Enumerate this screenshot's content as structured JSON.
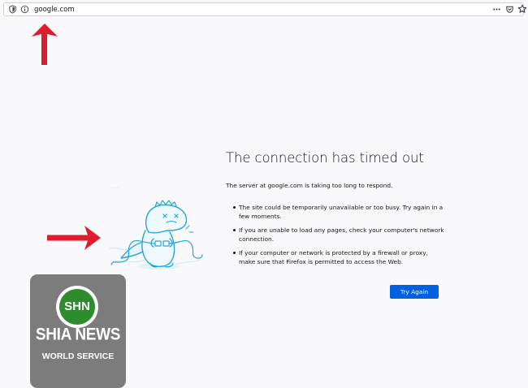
{
  "urlbar": {
    "url": "google.com",
    "icons": [
      "tracking-shield-icon",
      "site-info-icon",
      "page-actions-icon",
      "pocket-icon",
      "bookmark-star-icon"
    ]
  },
  "annotations": {
    "color": "#e01b2e",
    "icons": [
      "red-arrow-up-icon",
      "red-arrow-right-icon"
    ]
  },
  "error": {
    "title": "The connection has timed out",
    "description": "The server at google.com is taking too long to respond.",
    "reasons": [
      "The site could be temporarily unavailable or too busy. Try again in a few moments.",
      "If you are unable to load any pages, check your computer's network connection.",
      "If your computer or network is protected by a firewall or proxy, make sure that Firefox is permitted to access the Web."
    ],
    "button": "Try Again",
    "accent": "#0061e0",
    "illustration": "dinosaur-tangled-cable-illustration"
  },
  "watermark": {
    "logo": "SHN",
    "name": "SHIA NEWS",
    "service": "WORLD SERVICE",
    "logo_color": "#2e8b2e",
    "box_color": "#7c7c7c"
  }
}
